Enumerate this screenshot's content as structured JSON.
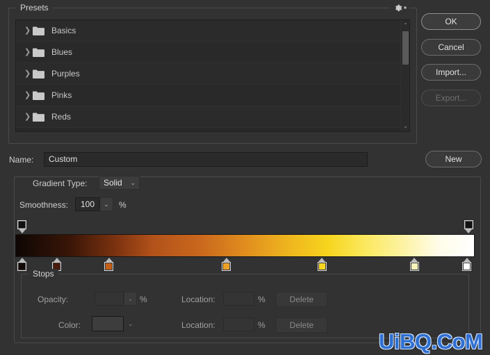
{
  "dialog": {
    "background": "#323232"
  },
  "presets": {
    "title": "Presets",
    "gear_icon": "gear-icon",
    "items": [
      {
        "label": "Basics",
        "icon": "folder-icon",
        "chevron": "chevron-right-icon"
      },
      {
        "label": "Blues",
        "icon": "folder-icon",
        "chevron": "chevron-right-icon"
      },
      {
        "label": "Purples",
        "icon": "folder-icon",
        "chevron": "chevron-right-icon"
      },
      {
        "label": "Pinks",
        "icon": "folder-icon",
        "chevron": "chevron-right-icon"
      },
      {
        "label": "Reds",
        "icon": "folder-icon",
        "chevron": "chevron-right-icon"
      }
    ],
    "scrollbar": {
      "up_arrow": "⌃",
      "down_arrow": "⌄"
    }
  },
  "buttons": {
    "ok": "OK",
    "cancel": "Cancel",
    "import": "Import...",
    "export": "Export...",
    "new": "New"
  },
  "name_row": {
    "label": "Name:",
    "value": "Custom",
    "placeholder": "Custom"
  },
  "gradient": {
    "type_label": "Gradient Type:",
    "type_value": "Solid",
    "smoothness_label": "Smoothness:",
    "smoothness_value": "100",
    "percent": "%",
    "chevron": "⌄",
    "bar_css": "linear-gradient(to right, #0d0603 0%, #1d0c05 4%, #3a1607 12%, #7d3310 22%, #b3521a 30%, #c9671d 40%, #e08d1e 50%, #eeb31f 59%, #f6d41d 68%, #fbe85c 76%, #fdf3a8 85%, #fefce8 92%, #ffffff 100%)",
    "stops": {
      "opacity": [
        {
          "name": "opacity-stop-left",
          "position_pct": 1.4,
          "color": "#111111"
        },
        {
          "name": "opacity-stop-right",
          "position_pct": 98.6,
          "color": "#111111"
        }
      ],
      "color": [
        {
          "name": "color-stop-1",
          "position_pct": 1.4,
          "color": "#120806"
        },
        {
          "name": "color-stop-2",
          "position_pct": 9.0,
          "color": "#4a1a0b"
        },
        {
          "name": "color-stop-3",
          "position_pct": 20.3,
          "color": "#c45f18"
        },
        {
          "name": "color-stop-4",
          "position_pct": 45.9,
          "color": "#eda027"
        },
        {
          "name": "color-stop-5",
          "position_pct": 66.7,
          "color": "#f7d521"
        },
        {
          "name": "color-stop-6",
          "position_pct": 86.8,
          "color": "#fcf3bb"
        },
        {
          "name": "color-stop-7",
          "position_pct": 98.2,
          "color": "#ffffff"
        }
      ]
    }
  },
  "stops_panel": {
    "title": "Stops",
    "opacity_label": "Opacity:",
    "opacity_value": "",
    "opacity_percent": "%",
    "color_label": "Color:",
    "color_value": "",
    "location_label_1": "Location:",
    "location_value_1": "",
    "location_percent_1": "%",
    "location_label_2": "Location:",
    "location_value_2": "",
    "location_percent_2": "%",
    "delete_label_1": "Delete",
    "delete_label_2": "Delete",
    "chevron": "⌄"
  },
  "watermark": {
    "text": "UiBQ.CoM",
    "color": "#2f6fd0"
  }
}
